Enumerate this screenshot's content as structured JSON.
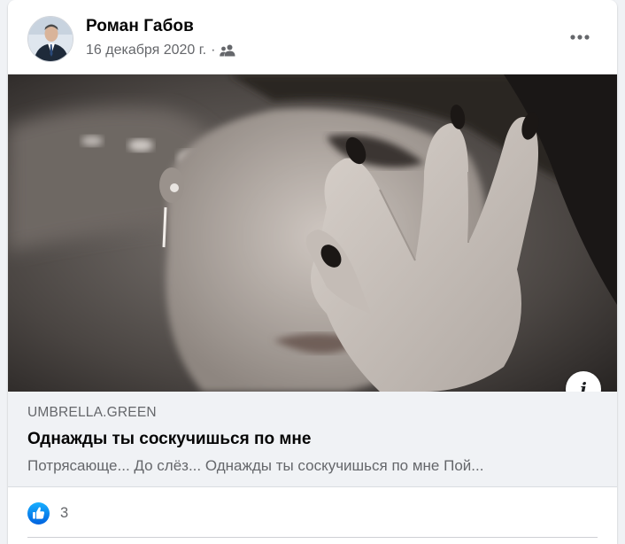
{
  "post": {
    "author": "Роман Габов",
    "date": "16 декабря 2020 г.",
    "separator": "·",
    "audience_icon": "friends-icon",
    "more_icon": "more-horizontal-icon"
  },
  "link_preview": {
    "domain": "UMBRELLA.GREEN",
    "title": "Однажды ты соскучишься по мне",
    "description": "Потрясающе... До слёз... Однажды ты соскучишься по мне Пой...",
    "info_icon": "info-icon"
  },
  "reactions": {
    "icon": "like-icon",
    "count": "3"
  },
  "colors": {
    "accent": "#1877f2",
    "secondary_text": "#65676b",
    "primary_text": "#050505",
    "link_bg": "#f0f2f5"
  }
}
